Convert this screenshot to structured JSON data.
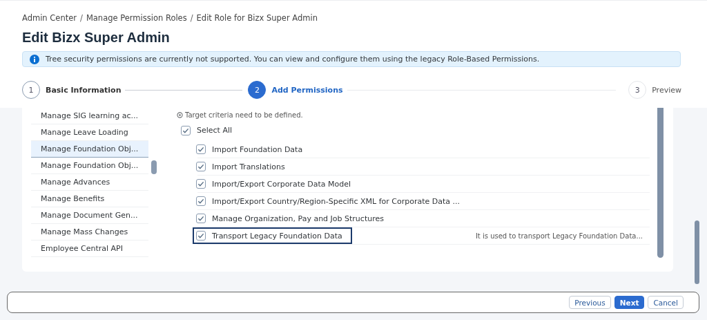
{
  "breadcrumb": [
    {
      "label": "Admin Center",
      "kind": "link"
    },
    {
      "label": "/",
      "kind": "separator"
    },
    {
      "label": "Manage Permission Roles",
      "kind": "link"
    },
    {
      "label": "/",
      "kind": "separator"
    },
    {
      "label": "Edit Role for Bizx Super Admin",
      "kind": "current"
    }
  ],
  "title": "Edit Bizx Super Admin",
  "info_message": "Tree security permissions are currently not supported. You can view and configure them using the legacy Role-Based Permissions.",
  "steps": [
    {
      "number": "1",
      "label": "Basic Information",
      "selected": false
    },
    {
      "number": "2",
      "label": "Add Permissions",
      "selected": true
    },
    {
      "number": "3",
      "label": "Preview",
      "selected": false
    }
  ],
  "sidebar": {
    "items": [
      {
        "label": "Manage SIG learning ac...",
        "selected": false
      },
      {
        "label": "Manage Leave Loading",
        "selected": false
      },
      {
        "label": "Manage Foundation Obj...",
        "selected": true
      },
      {
        "label": "Manage Foundation Obj...",
        "selected": false
      },
      {
        "label": "Manage Advances",
        "selected": false
      },
      {
        "label": "Manage Benefits",
        "selected": false
      },
      {
        "label": "Manage Document Gen...",
        "selected": false
      },
      {
        "label": "Manage Mass Changes",
        "selected": false
      },
      {
        "label": "Employee Central API",
        "selected": false
      }
    ]
  },
  "legend_note": "Target criteria need to be defined.",
  "select_all": {
    "label": "Select All",
    "checked": true
  },
  "permissions": [
    {
      "label": "Import Foundation Data",
      "checked": true,
      "focused": false
    },
    {
      "label": "Import Translations",
      "checked": true,
      "focused": false
    },
    {
      "label": "Import/Export Corporate Data Model",
      "checked": true,
      "focused": false
    },
    {
      "label": "Import/Export Country/Region-Specific XML for Corporate Data ...",
      "checked": true,
      "focused": false
    },
    {
      "label": "Manage Organization, Pay and Job Structures",
      "checked": true,
      "focused": false
    },
    {
      "label": "Transport Legacy Foundation Data",
      "checked": true,
      "focused": true,
      "description": "It is used to transport Legacy Foundation Data..."
    }
  ],
  "buttons": [
    {
      "label": "Previous",
      "kind": "secondary"
    },
    {
      "label": "Next",
      "kind": "primary"
    },
    {
      "label": "Cancel",
      "kind": "secondary"
    }
  ]
}
